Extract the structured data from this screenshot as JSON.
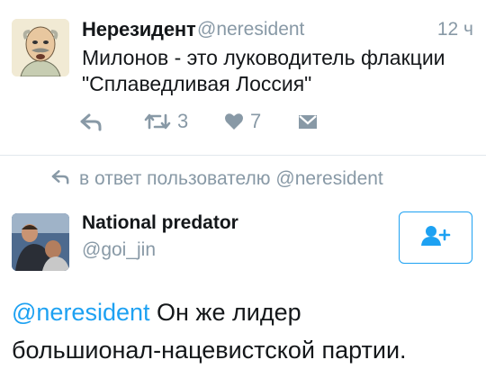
{
  "tweet": {
    "author_name": "Нерезидент",
    "author_handle": "@neresident",
    "time": "12 ч",
    "text_line1": "Милонов - это луководитель флакции",
    "text_line2": "\"Сплаведливая Лоссия\"",
    "actions": {
      "retweet_count": "3",
      "like_count": "7"
    }
  },
  "reply": {
    "context_text": "в ответ пользователю @neresident",
    "author_name": "National predator",
    "author_handle": "@goi_jin",
    "mention": "@neresident",
    "text_line1_rest": " Он же лидер",
    "text_line2": "большионал-нацевистской партии."
  },
  "colors": {
    "accent": "#1da1f2",
    "muted": "#8899a6",
    "divider": "#e1e8ed"
  },
  "icons": [
    "reply-icon",
    "retweet-icon",
    "heart-icon",
    "direct-message-icon",
    "add-user-icon"
  ]
}
